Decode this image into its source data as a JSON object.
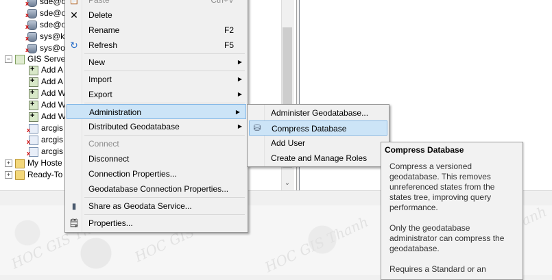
{
  "tree": {
    "items": [
      {
        "label": "sde@o",
        "kind": "db"
      },
      {
        "label": "sde@o",
        "kind": "db"
      },
      {
        "label": "sde@o",
        "kind": "db"
      },
      {
        "label": "sys@k",
        "kind": "db"
      },
      {
        "label": "sys@o",
        "kind": "db"
      },
      {
        "label": "GIS Server",
        "kind": "server",
        "expander": "−"
      },
      {
        "label": "Add A",
        "kind": "add"
      },
      {
        "label": "Add A",
        "kind": "add"
      },
      {
        "label": "Add W",
        "kind": "add"
      },
      {
        "label": "Add W",
        "kind": "add"
      },
      {
        "label": "Add W",
        "kind": "add"
      },
      {
        "label": "arcgis",
        "kind": "arcgis"
      },
      {
        "label": "arcgis",
        "kind": "arcgis"
      },
      {
        "label": "arcgis",
        "kind": "arcgis"
      },
      {
        "label": "My Hoste",
        "kind": "folder",
        "expander": "+"
      },
      {
        "label": "Ready-To",
        "kind": "folder",
        "expander": "+"
      }
    ],
    "scroll_down_glyph": "⌄"
  },
  "context_menu": {
    "items": [
      {
        "label": "Paste",
        "shortcut": "Ctrl+V",
        "disabled": true,
        "icon": "paste-icon"
      },
      {
        "label": "Delete",
        "icon": "delete-icon"
      },
      {
        "label": "Rename",
        "shortcut": "F2"
      },
      {
        "label": "Refresh",
        "shortcut": "F5",
        "icon": "refresh-icon"
      },
      {
        "label": "New",
        "submenu": true
      },
      {
        "label": "Import",
        "submenu": true
      },
      {
        "label": "Export",
        "submenu": true
      },
      {
        "label": "Administration",
        "submenu": true,
        "highlighted": true
      },
      {
        "label": "Distributed Geodatabase",
        "submenu": true
      },
      {
        "label": "Connect",
        "disabled": true
      },
      {
        "label": "Disconnect"
      },
      {
        "label": "Connection Properties..."
      },
      {
        "label": "Geodatabase Connection Properties..."
      },
      {
        "label": "Share as Geodata Service...",
        "icon": "share-service-icon"
      },
      {
        "label": "Properties...",
        "icon": "properties-icon"
      }
    ]
  },
  "admin_submenu": {
    "items": [
      {
        "label": "Administer Geodatabase..."
      },
      {
        "label": "Compress Database",
        "highlighted": true,
        "icon": "compress-database-icon"
      },
      {
        "label": "Add User"
      },
      {
        "label": "Create and Manage Roles"
      }
    ]
  },
  "tooltip": {
    "title": "Compress Database",
    "paragraphs": [
      "Compress a versioned geodatabase. This removes unreferenced states from the states tree, improving query performance.",
      "Only the geodatabase administrator can compress the geodatabase.",
      "Requires a Standard or an"
    ]
  },
  "watermark": {
    "text": "HOC GIS Thanh"
  },
  "colors": {
    "highlight": "#cce4f7",
    "highlight_border": "#84b8e6",
    "menu_bg": "#f0f0f0",
    "disabled_text": "#8d8d8d"
  }
}
